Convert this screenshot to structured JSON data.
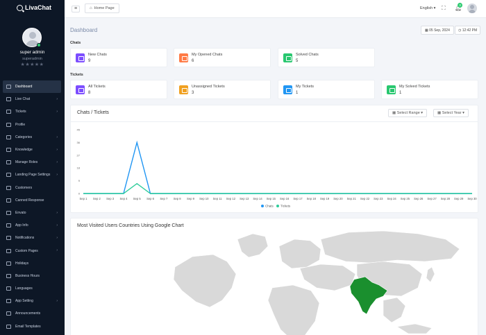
{
  "brand": {
    "name": "LivaChat"
  },
  "user": {
    "name": "super admin",
    "role": "superadmin",
    "rating_stars": "★★★★★"
  },
  "sidebar": {
    "items": [
      {
        "label": "Dashboard",
        "active": true,
        "has_children": false,
        "icon": "grid-icon"
      },
      {
        "label": "Live Chat",
        "has_children": true,
        "icon": "chat-icon"
      },
      {
        "label": "Tickets",
        "has_children": true,
        "icon": "ticket-icon"
      },
      {
        "label": "Profile",
        "has_children": false,
        "icon": "user-icon"
      },
      {
        "label": "Categories",
        "has_children": true,
        "icon": "folder-icon"
      },
      {
        "label": "Knowledge",
        "has_children": true,
        "icon": "book-icon"
      },
      {
        "label": "Manage Roles",
        "has_children": true,
        "icon": "key-icon"
      },
      {
        "label": "Landing Page Settings",
        "has_children": true,
        "icon": "layout-icon"
      },
      {
        "label": "Customers",
        "has_children": false,
        "icon": "users-icon"
      },
      {
        "label": "Canned Response",
        "has_children": false,
        "icon": "message-icon"
      },
      {
        "label": "Envato",
        "has_children": true,
        "icon": "leaf-icon"
      },
      {
        "label": "App Info",
        "has_children": true,
        "icon": "info-icon"
      },
      {
        "label": "Notifications",
        "has_children": true,
        "icon": "bell-icon"
      },
      {
        "label": "Custom Pages",
        "has_children": true,
        "icon": "file-icon"
      },
      {
        "label": "Holidays",
        "has_children": false,
        "icon": "calendar-icon"
      },
      {
        "label": "Business Hours",
        "has_children": false,
        "icon": "clock-icon"
      },
      {
        "label": "Languages",
        "has_children": false,
        "icon": "globe-icon"
      },
      {
        "label": "App Setting",
        "has_children": true,
        "icon": "gear-icon"
      },
      {
        "label": "Announcements",
        "has_children": false,
        "icon": "megaphone-icon"
      },
      {
        "label": "Email Templates",
        "has_children": false,
        "icon": "mail-icon"
      }
    ]
  },
  "topbar": {
    "breadcrumb": "Home Page",
    "language": "English",
    "notification_count": "3"
  },
  "main": {
    "title": "Dashboard",
    "date": "05 Sep, 2024",
    "time": "12:42 PM",
    "chats_section": "Chats",
    "tickets_section": "Tickets",
    "chat_cards": [
      {
        "label": "New Chats",
        "value": "9",
        "color": "#7c4dff"
      },
      {
        "label": "My Opened Chats",
        "value": "6",
        "color": "#ff7a45"
      },
      {
        "label": "Solved Chats",
        "value": "5",
        "color": "#28c76f"
      }
    ],
    "ticket_cards": [
      {
        "label": "All Tickets",
        "value": "8",
        "color": "#7c4dff"
      },
      {
        "label": "Unassigned Tickets",
        "value": "3",
        "color": "#f0a020"
      },
      {
        "label": "My Tickets",
        "value": "1",
        "color": "#2196f3"
      },
      {
        "label": "My Solved Tickets",
        "value": "1",
        "color": "#28c76f"
      }
    ],
    "chart_panel": {
      "title": "Chats / Tickets",
      "select_range": "Select Range",
      "select_year": "Select Year"
    },
    "map_panel": {
      "title": "Most Visited Users Countries Using Google Chart"
    }
  },
  "colors": {
    "sidebar_bg": "#0d1726",
    "chats_line": "#2196f3",
    "tickets_line": "#2ecc9a",
    "map_land": "#d9d9d9",
    "map_highlight": "#1a8f2e"
  },
  "chart_data": {
    "type": "line",
    "categories": [
      "Sep 1",
      "Sep 2",
      "Sep 3",
      "Sep 4",
      "Sep 5",
      "Sep 6",
      "Sep 7",
      "Sep 8",
      "Sep 9",
      "Sep 10",
      "Sep 11",
      "Sep 12",
      "Sep 13",
      "Sep 14",
      "Sep 15",
      "Sep 16",
      "Sep 17",
      "Sep 18",
      "Sep 19",
      "Sep 20",
      "Sep 21",
      "Sep 22",
      "Sep 23",
      "Sep 24",
      "Sep 25",
      "Sep 26",
      "Sep 27",
      "Sep 28",
      "Sep 29",
      "Sep 30"
    ],
    "series": [
      {
        "name": "Chats",
        "color": "#2196f3",
        "values": [
          0,
          0,
          0,
          0,
          36,
          0,
          0,
          0,
          0,
          0,
          0,
          0,
          0,
          0,
          0,
          0,
          0,
          0,
          0,
          0,
          0,
          0,
          0,
          0,
          0,
          0,
          0,
          0,
          0,
          0
        ]
      },
      {
        "name": "Tickets",
        "color": "#2ecc9a",
        "values": [
          0,
          0,
          0,
          0,
          7,
          0,
          0,
          0,
          0,
          0,
          0,
          0,
          0,
          0,
          0,
          0,
          0,
          0,
          0,
          0,
          0,
          0,
          0,
          0,
          0,
          0,
          0,
          0,
          0,
          0
        ]
      }
    ],
    "yticks": [
      0,
      9,
      18,
      27,
      36,
      45
    ],
    "ylim": [
      0,
      45
    ],
    "legend": "bottom",
    "grid": false
  }
}
